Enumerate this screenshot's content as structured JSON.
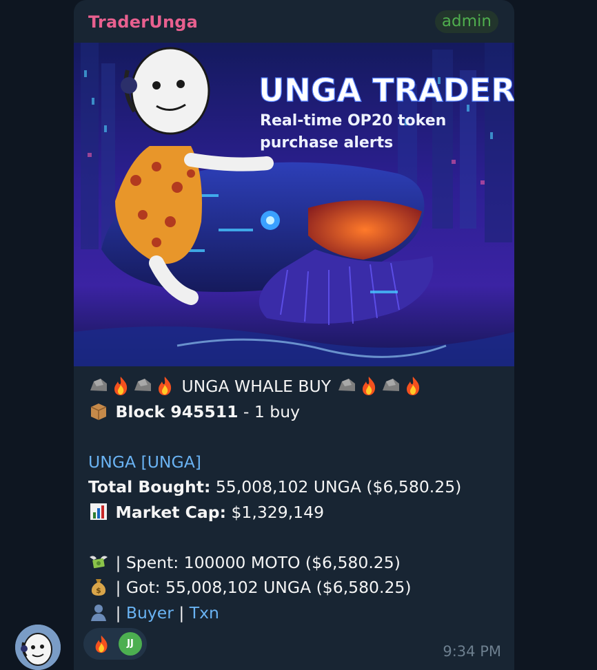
{
  "chat": {
    "sender_name": "TraderUnga",
    "role_badge": "admin",
    "time": "9:34 PM"
  },
  "banner": {
    "title": "UNGA TRADER",
    "subtitle_line1": "Real-time OP20 token",
    "subtitle_line2": "purchase alerts"
  },
  "message": {
    "headline": "UNGA WHALE BUY",
    "block_label": "Block 945511",
    "block_suffix": " - 1 buy",
    "token_line": "UNGA [UNGA]",
    "total_bought_label": "Total Bought:",
    "total_bought_value": " 55,008,102 UNGA ($6,580.25)",
    "market_cap_label": "Market Cap:",
    "market_cap_value": " $1,329,149",
    "spent_text": " | Spent: 100000 MOTO ($6,580.25)",
    "got_text": " | Got: 55,008,102 UNGA ($6,580.25)",
    "pipe": " | ",
    "buyer_link": "Buyer",
    "txn_link": "Txn"
  },
  "reactions": {
    "emoji": "fire-icon",
    "avatar_initials": "JJ",
    "avatar_color": "#4caf50"
  },
  "colors": {
    "background": "#0e1621",
    "bubble": "#182533",
    "sender": "#e8608f",
    "badge_text": "#4fae4e",
    "link": "#6ab3f3",
    "time": "#6d7f8f"
  }
}
